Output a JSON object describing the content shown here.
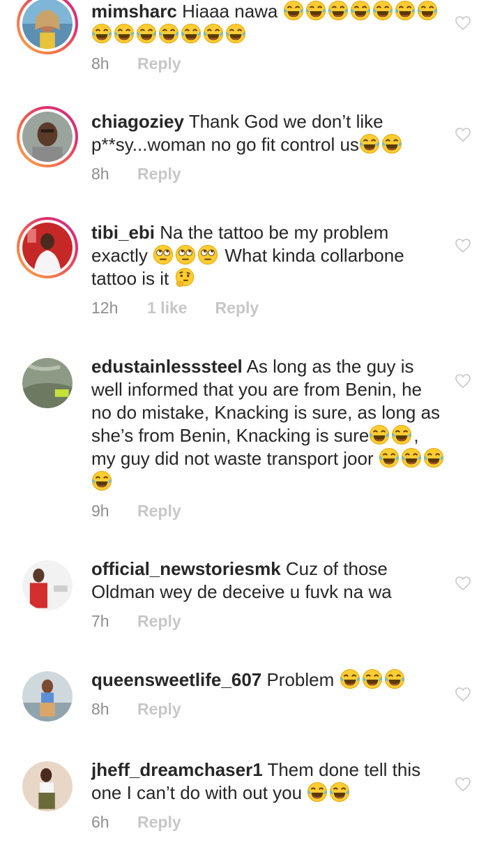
{
  "comments": [
    {
      "username": "mimsharc",
      "text_parts": [
        "Hiaaa nawa "
      ],
      "emoji": {
        "laugh": 14
      },
      "time": "8h",
      "likes": "",
      "reply": "Reply"
    },
    {
      "username": "chiagoziey",
      "text": "Thank God we don’t like p**sy...woman no go fit control us",
      "time": "8h",
      "reply": "Reply"
    },
    {
      "username": "tibi_ebi",
      "text_a": "Na the tattoo be my problem exactly",
      "text_b": "What kinda collarbone tattoo is it",
      "time": "12h",
      "likes": "1 like",
      "reply": "Reply"
    },
    {
      "username": "edustainlesssteel",
      "text_a": "As long as the guy is well informed that you are from Benin, he no do mistake, Knacking is sure, as long as she’s from Benin, Knacking is sure",
      "text_b": ", my guy did not waste transport joor",
      "time": "9h",
      "reply": "Reply"
    },
    {
      "username": "official_newstoriesmk",
      "text": "Cuz of those Oldman wey de deceive u fuvk na wa",
      "time": "7h",
      "reply": "Reply"
    },
    {
      "username": "queensweetlife_607",
      "text": "Problem",
      "time": "8h",
      "reply": "Reply"
    },
    {
      "username": "jheff_dreamchaser1",
      "text": "Them done tell this one I can’t do with out you",
      "time": "6h",
      "reply": "Reply"
    }
  ],
  "colors": {
    "text": "#262626",
    "meta": "#8e8e8e",
    "reply": "#c7c7c7",
    "story_ring_start": "#f9b04a",
    "story_ring_end": "#c13584"
  },
  "icons": {
    "like": "heart-outline-icon",
    "laugh": "face-with-tears-of-joy-emoji",
    "eyeroll": "face-with-rolling-eyes-emoji",
    "thinking": "thinking-face-emoji"
  }
}
